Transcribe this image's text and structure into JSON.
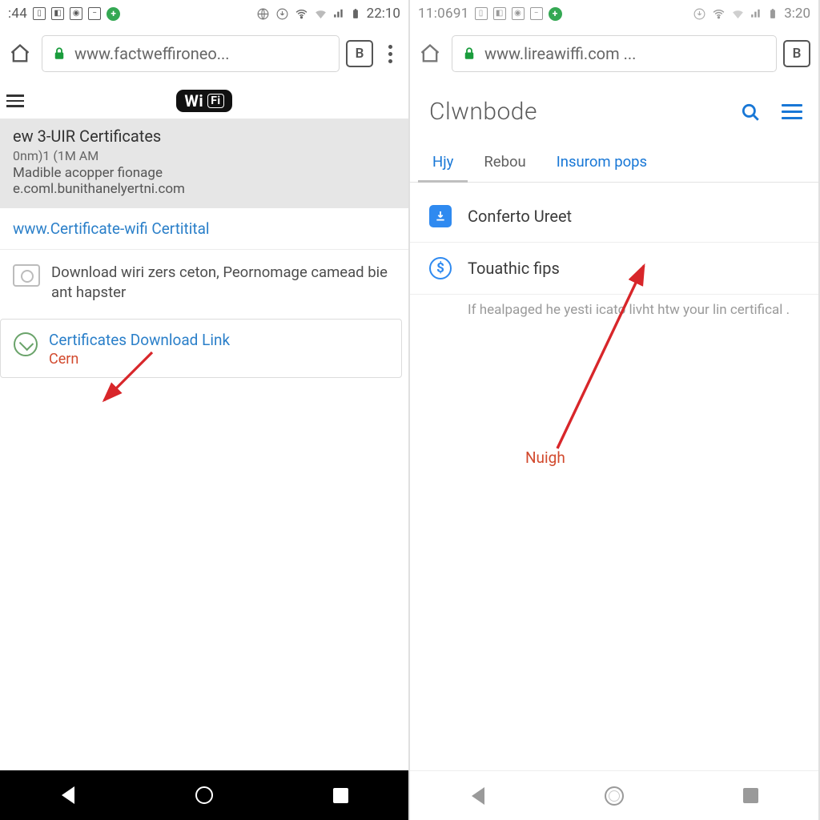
{
  "left": {
    "status": {
      "time": ":44",
      "clock": "22:10"
    },
    "url": "www.factweffironeo...",
    "tab_count": "B",
    "page": {
      "wifi_badge": "Wi",
      "wifi_badge_suffix": "Fi",
      "block_title": "ew 3-UIR Certificates",
      "block_meta1": "0nm)1 (1M AM",
      "block_meta2": "Madible acopper fionage",
      "block_meta3": "e.coml.bunithanelyertni.com",
      "cert_row": "www.Certificate-wifi Certitital",
      "desc": "Download wiri zers ceton, Peornomage camead bie ant hapster",
      "card_title": "Certificates Download Link",
      "card_sub": "Cern"
    }
  },
  "right": {
    "status": {
      "time": "11:0691",
      "clock": "3:20"
    },
    "url": "www.lireawiffi.com ...",
    "tab_count": "B",
    "site_title": "Clwnbode",
    "tabs": {
      "t1": "Hjy",
      "t2": "Rebou",
      "t3": "Insurom pops"
    },
    "rows": {
      "r1": "Conferto Ureet",
      "r2": "Touathic fips"
    },
    "hint": "If healpaged he yesti icato livht htw your lin certifical .",
    "callout": "Nuigh"
  }
}
